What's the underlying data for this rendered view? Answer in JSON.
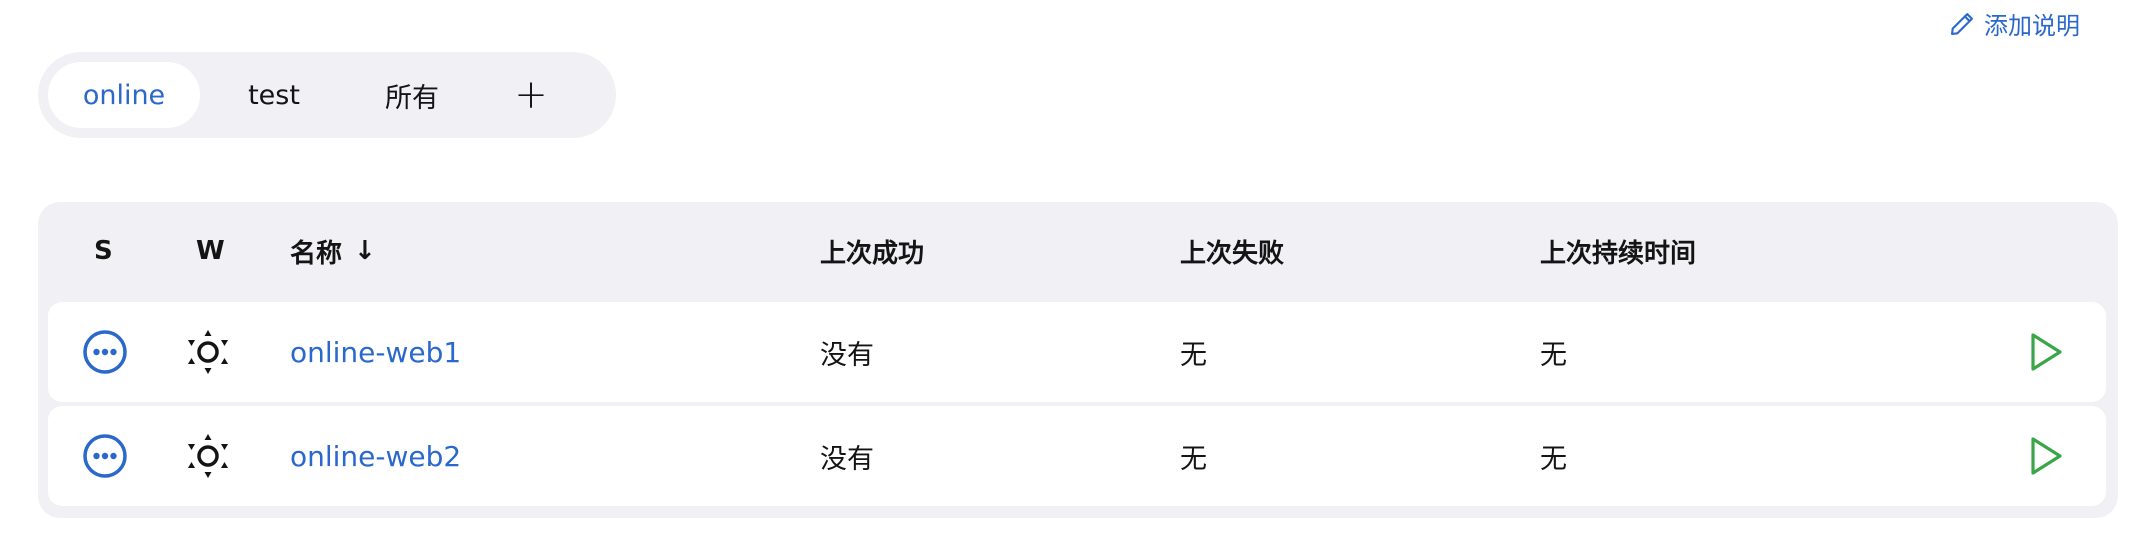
{
  "header": {
    "add_description_label": "添加说明",
    "add_description_icon": "pencil-icon"
  },
  "views": {
    "tabs": [
      {
        "label": "online",
        "active": true
      },
      {
        "label": "test",
        "active": false
      },
      {
        "label": "所有",
        "active": false
      }
    ],
    "add_tab_label": "+"
  },
  "table": {
    "columns": {
      "s": "S",
      "w": "W",
      "name": "名称",
      "name_sort": "↓",
      "last_success": "上次成功",
      "last_failure": "上次失败",
      "last_duration": "上次持续时间"
    },
    "rows": [
      {
        "status_icon": "status-pending-icon",
        "weather_icon": "sunny-icon",
        "name": "online-web1",
        "last_success": "没有",
        "last_failure": "无",
        "last_duration": "无",
        "action_icon": "play-icon"
      },
      {
        "status_icon": "status-pending-icon",
        "weather_icon": "sunny-icon",
        "name": "online-web2",
        "last_success": "没有",
        "last_failure": "无",
        "last_duration": "无",
        "action_icon": "play-icon"
      }
    ]
  },
  "colors": {
    "accent": "#2b68cc",
    "play": "#3aa64a",
    "panel_bg": "#f1f1f5"
  }
}
